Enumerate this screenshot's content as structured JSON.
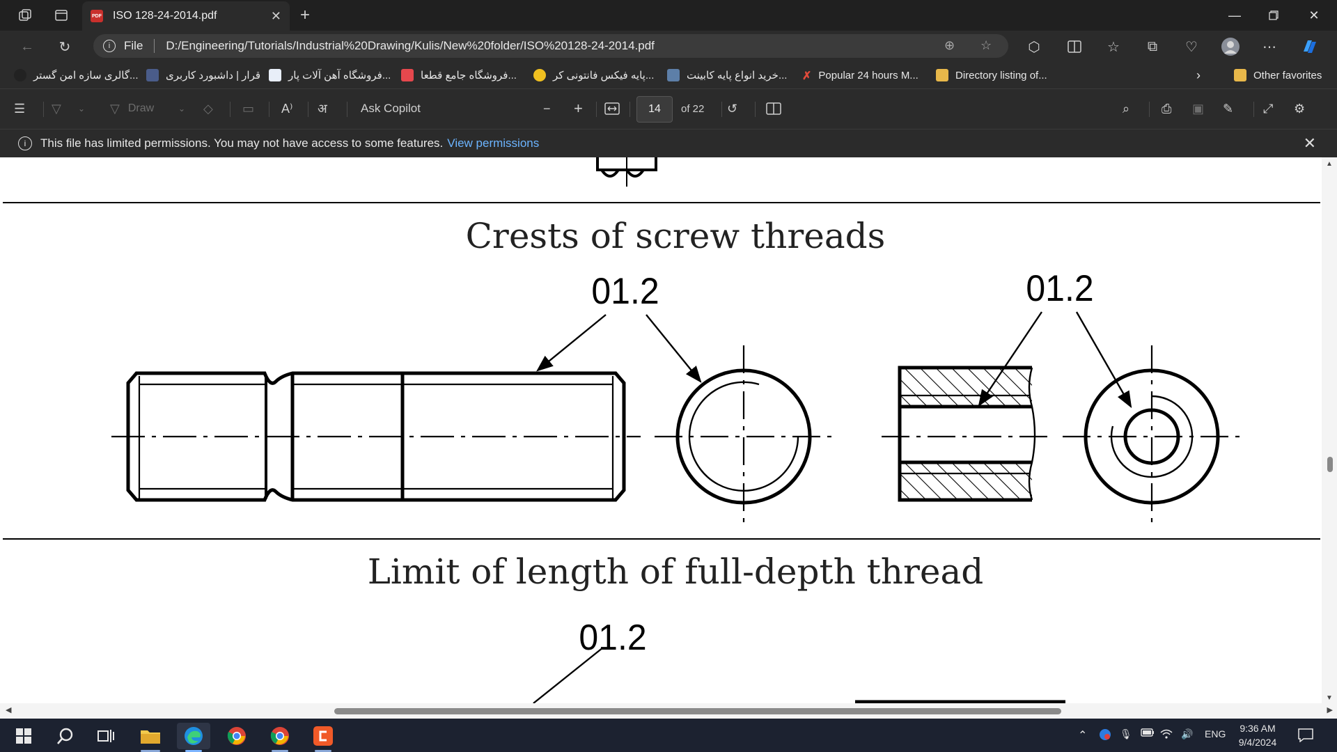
{
  "browser": {
    "tab_title": "ISO 128-24-2014.pdf",
    "file_label": "File",
    "url": "D:/Engineering/Tutorials/Industrial%20Drawing/Kulis/New%20folder/ISO%20128-24-2014.pdf"
  },
  "bookmarks": [
    "گالری سازه امن گستر...",
    "قرار | داشبورد کاربری",
    "فروشگاه آهن آلات پار...",
    "فروشگاه جامع قطعا...",
    "پایه فیکس فانتونی کر...",
    "خرید انواع پایه کابینت...",
    "Popular 24 hours M...",
    "Directory listing of..."
  ],
  "other_favorites": "Other favorites",
  "pdf_toolbar": {
    "draw_label": "Draw",
    "copilot_label": "Ask Copilot",
    "page_current": "14",
    "page_total": "of 22"
  },
  "banner": {
    "message": "This file has limited permissions. You may not have access to some features.",
    "link": "View permissions"
  },
  "document": {
    "section1_title": "Crests of screw threads",
    "label_a": "01.2",
    "label_b": "01.2",
    "section2_title": "Limit of length of full-depth thread",
    "label_c": "01.2"
  },
  "taskbar": {
    "language": "ENG",
    "time": "9:36 AM",
    "date": "9/4/2024"
  },
  "colors": {
    "accent_link": "#6cb4ff",
    "taskbar_bg": "#1c2230",
    "chrome_bg": "#2b2b2b"
  }
}
